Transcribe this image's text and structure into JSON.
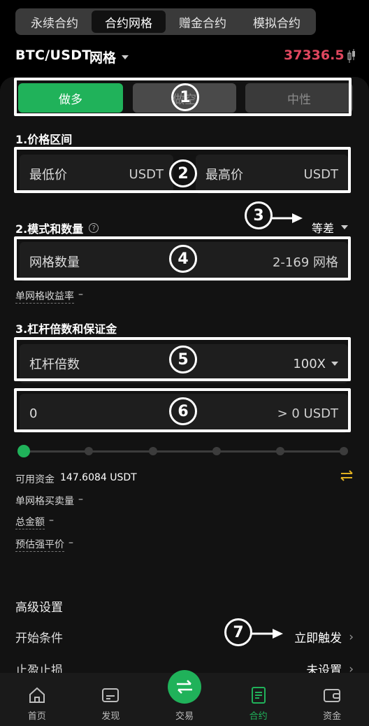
{
  "top_tabs": [
    {
      "label": "永续合约",
      "active": false
    },
    {
      "label": "合约网格",
      "active": true
    },
    {
      "label": "赠金合约",
      "active": false
    },
    {
      "label": "模拟合约",
      "active": false
    }
  ],
  "header": {
    "pair": "BTC/USDT",
    "type": "网格",
    "price": "37336.5",
    "price_color": "#e0475f"
  },
  "direction": {
    "long": "做多",
    "short": "做空",
    "neutral": "中性",
    "active_color": "#20b25a"
  },
  "section1": {
    "title": "1.价格区间",
    "min_label": "最低价",
    "min_unit": "USDT",
    "max_label": "最高价",
    "max_unit": "USDT"
  },
  "section2": {
    "title": "2.模式和数量",
    "mode": "等差",
    "grid_label": "网格数量",
    "grid_hint": "2-169 网格",
    "yield_label": "单网格收益率",
    "yield_value": "–"
  },
  "section3": {
    "title": "3.杠杆倍数和保证金",
    "leverage_label": "杠杆倍数",
    "leverage_value": "100X",
    "margin_value": "0",
    "margin_hint": "> 0 USDT"
  },
  "slider": {
    "value_fraction": 0
  },
  "info": {
    "available_label": "可用资金",
    "available_value": "147.6084 USDT",
    "per_grid_label": "单网格买卖量",
    "per_grid_value": "–",
    "total_label": "总金额",
    "total_value": "–",
    "liq_label": "预估强平价",
    "liq_value": "–"
  },
  "advanced": {
    "title": "高级设置",
    "start_label": "开始条件",
    "start_value": "立即触发",
    "tpsl_label": "止盈止损",
    "tpsl_value": "未设置"
  },
  "annotations": [
    "1",
    "2",
    "3",
    "4",
    "5",
    "6",
    "7"
  ],
  "bottom_nav": [
    {
      "label": "首页",
      "icon": "home-icon"
    },
    {
      "label": "发现",
      "icon": "discover-icon"
    },
    {
      "label": "交易",
      "icon": "trade-icon"
    },
    {
      "label": "合约",
      "icon": "contract-icon",
      "active": true
    },
    {
      "label": "资金",
      "icon": "wallet-icon"
    }
  ]
}
